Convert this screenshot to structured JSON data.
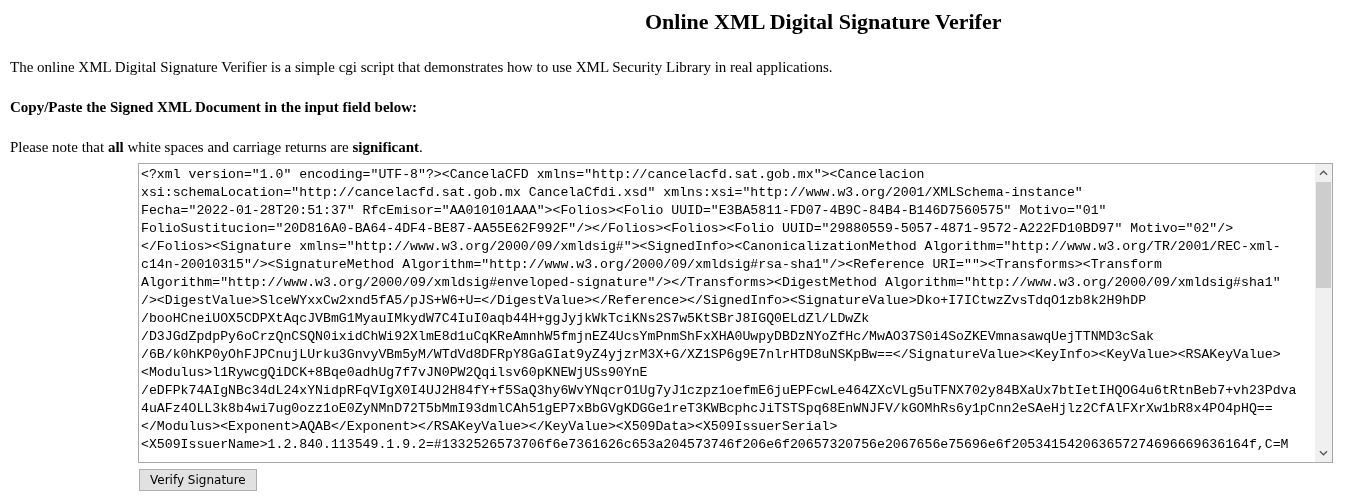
{
  "title": "Online XML Digital Signature Verifer",
  "intro": "The online XML Digital Signature Verifier is a simple cgi script that demonstrates how to use XML Security Library in real applications.",
  "instruction": "Copy/Paste the Signed XML Document in the input field below:",
  "note": "Please note that **all** white spaces and carriage returns are **significant**.",
  "input": {
    "value_lines": [
      "<?xml version=\"1.0\" encoding=\"UTF-8\"?><CancelaCFD xmlns=\"http://cancelacfd.sat.gob.mx\"><Cancelacion",
      "xsi:schemaLocation=\"http://cancelacfd.sat.gob.mx CancelaCfdi.xsd\" xmlns:xsi=\"http://www.w3.org/2001/XMLSchema-instance\"",
      "Fecha=\"2022-01-28T20:51:37\" RfcEmisor=\"AA010101AAA\"><Folios><Folio UUID=\"E3BA5811-FD07-4B9C-84B4-B146D7560575\" Motivo=\"01\"",
      "FolioSustitucion=\"20D816A0-BA64-4DF4-BE87-AA55E62F992F\"/></Folios><Folios><Folio UUID=\"29880559-5057-4871-9572-A222FD10BD97\" Motivo=\"02\"/>",
      "</Folios><Signature xmlns=\"http://www.w3.org/2000/09/xmldsig#\"><SignedInfo><CanonicalizationMethod Algorithm=\"http://www.w3.org/TR/2001/REC-xml-",
      "c14n-20010315\"/><SignatureMethod Algorithm=\"http://www.w3.org/2000/09/xmldsig#rsa-sha1\"/><Reference URI=\"\"><Transforms><Transform",
      "Algorithm=\"http://www.w3.org/2000/09/xmldsig#enveloped-signature\"/></Transforms><DigestMethod Algorithm=\"http://www.w3.org/2000/09/xmldsig#sha1\"",
      "/><DigestValue>SlceWYxxCw2xnd5fA5/pJS+W6+U=</DigestValue></Reference></SignedInfo><SignatureValue>Dko+I7ICtwzZvsTdqO1zb8k2H9hDP",
      "/booHCneiUOX5CDPXtAqcJVBmG1MyauIMkydW7C4IuI0aqb44H+ggJyjkWkTciKNs2S7w5KtSBrJ8IGQ0ELdZl/LDwZk",
      "/D3JGdZpdpPy6oCrzQnCSQN0ixidChWi92XlmE8d1uCqKReAmnhW5fmjnEZ4UcsYmPnmShFxXHA0UwpyDBDzNYoZfHc/MwAO37S0i4SoZKEVmnasawqUejTTNMD3cSak",
      "/6B/k0hKP0yOhFJPCnujLUrku3GnvyVBm5yM/WTdVd8DFRpY8GaGIat9yZ4yjzrM3X+G/XZ1SP6g9E7nlrHTD8uNSKpBw==</SignatureValue><KeyInfo><KeyValue><RSAKeyValue>",
      "<Modulus>l1RywcgQiDCK+8Bqe0adhUg7f7vJN0PW2Qqilsv60pKNEWjUSs90YnE",
      "/eDFPk74AIgNBc34dL24xYNidpRFqVIgX0I4UJ2H84fY+f5SaQ3hy6WvYNqcrO1Ug7yJ1czpz1oefmE6juEPFcwLe464ZXcVLg5uTFNX702y84BXaUx7btIetIHQOG4u6tRtnBeb7+vh23Pdva",
      "4uAFz4OLL3k8b4wi7ug0ozz1oE0ZyNMnD72T5bMmI93dmlCAh51gEP7xBbGVgKDGGe1reT3KWBcphcJiTSTSpq68EnWNJFV/kGOMhRs6y1pCnn2eSAeHjlz2CfAlFXrXw1bR8x4PO4pHQ==",
      "</Modulus><Exponent>AQAB</Exponent></RSAKeyValue></KeyValue><X509Data><X509IssuerSerial>",
      "<X509IssuerName>1.2.840.113549.1.9.2=#1332526573706f6e7361626c653a204573746f206e6f20657320756e2067656e75696e6f205341542063657274696669636164f,C=M"
    ]
  },
  "button": "Verify Signature"
}
